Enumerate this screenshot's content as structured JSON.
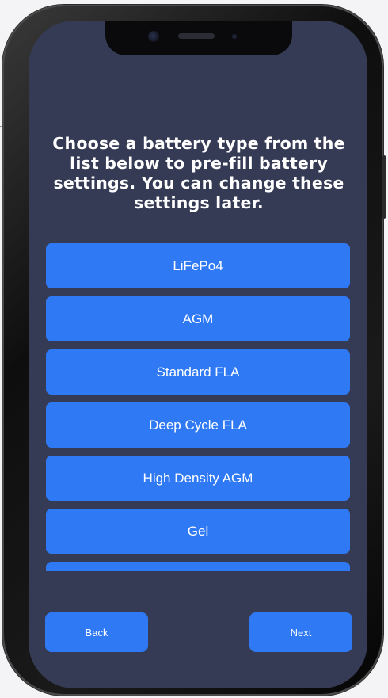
{
  "prompt": "Choose a battery type from the list below to pre-fill battery settings. You can change these settings later.",
  "battery_types": [
    "LiFePo4",
    "AGM",
    "Standard FLA",
    "Deep Cycle FLA",
    "High Density AGM",
    "Gel",
    ""
  ],
  "nav": {
    "back_label": "Back",
    "next_label": "Next"
  },
  "colors": {
    "screen_bg": "#363b55",
    "button": "#2f79f4",
    "text": "#ffffff"
  }
}
